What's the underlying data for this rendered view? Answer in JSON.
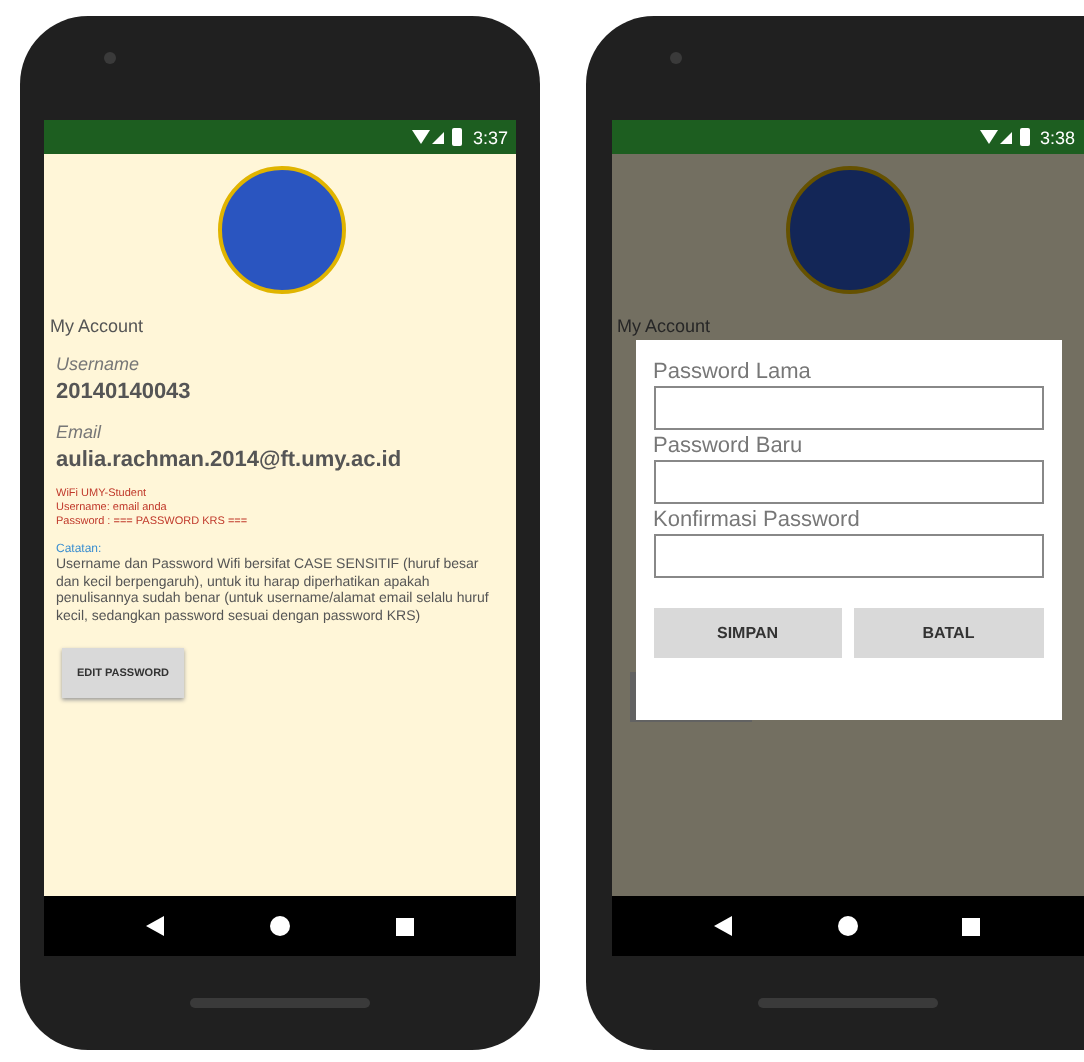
{
  "phones": [
    {
      "kind": "account",
      "status_time": "3:37",
      "section_title": "My Account",
      "username_label": "Username",
      "username": "20140140043",
      "email_label": "Email",
      "email": "aulia.rachman.2014@ft.umy.ac.id",
      "wifi_lines": [
        "WiFi UMY-Student",
        "Username: email anda",
        "Password : === PASSWORD KRS ==="
      ],
      "note_title": "Catatan:",
      "note": "Username dan Password Wifi bersifat CASE SENSITIF (huruf besar dan kecil berpengaruh), untuk itu harap diperhatikan apakah penulisannya sudah benar (untuk username/alamat email selalu huruf kecil, sedangkan password sesuai dengan password KRS)",
      "button": "EDIT PASSWORD"
    },
    {
      "kind": "dialog",
      "status_time": "3:38",
      "section_title": "My Account",
      "fields": [
        {
          "label": "Password Lama"
        },
        {
          "label": "Password Baru"
        },
        {
          "label": "Konfirmasi Password"
        }
      ],
      "buttons": [
        "SIMPAN",
        "BATAL"
      ]
    }
  ]
}
